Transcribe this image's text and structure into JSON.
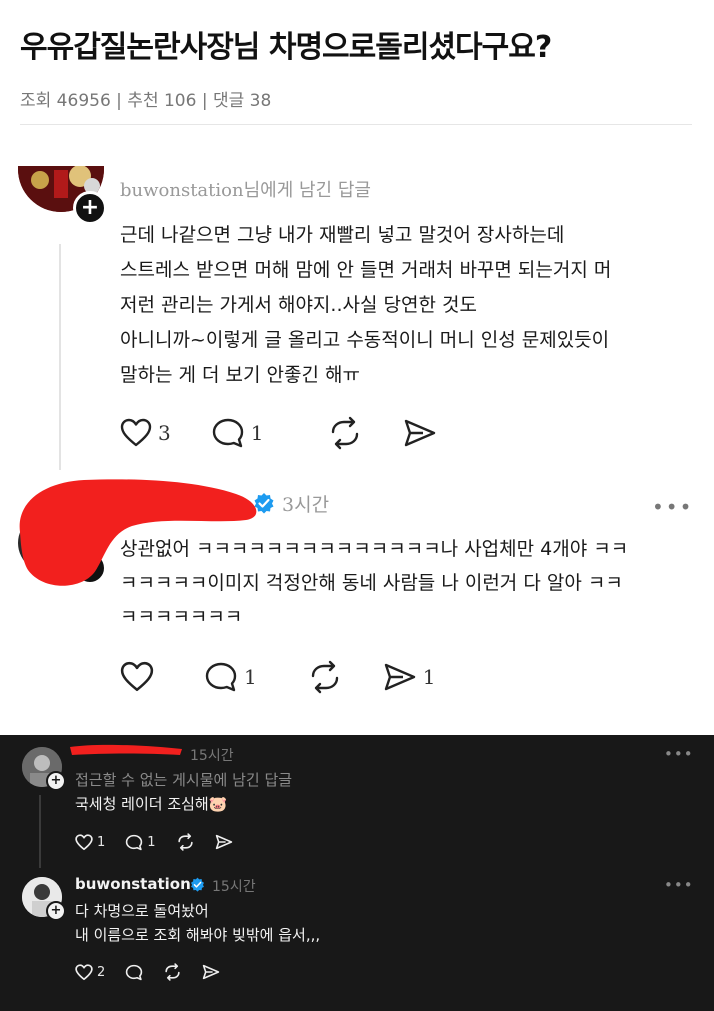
{
  "post": {
    "title": "우유갑질논란사장님 차명으로돌리셨다구요?",
    "stats": "조회 46956 | 추천 106 | 댓글 38"
  },
  "comment1": {
    "reply_to": "buwonstation님에게 남긴 답글",
    "lines": [
      "근데 나같으면 그냥 내가 재빨리 넣고 말것어 장사하는데",
      "스트레스 받으면 머해 맘에 안 들면 거래처 바꾸면 되는거지 머",
      "저런 관리는 가게서 해야지..사실 당연한 것도",
      "아니니까~이렇게 글 올리고 수동적이니 머니 인성 문제있듯이",
      "말하는 게 더 보기 안좋긴 해ㅠ"
    ],
    "likes": "3",
    "replies": "1"
  },
  "comment2": {
    "time": "3시간",
    "lines": [
      "상관없어 ㅋㅋㅋㅋㅋㅋㅋㅋㅋㅋㅋㅋㅋㅋ나 사업체만 4개야 ㅋㅋ",
      "ㅋㅋㅋㅋㅋ이미지 걱정안해 동네 사람들 나 이런거 다 알아 ㅋㅋ",
      "ㅋㅋㅋㅋㅋㅋㅋ"
    ],
    "replies": "1",
    "shares": "1"
  },
  "dark1": {
    "time": "15시간",
    "sub": "접근할 수 없는 게시물에 남긴 답글",
    "text": "국세청 레이더 조심해🐷",
    "likes": "1",
    "replies": "1"
  },
  "dark2": {
    "name": "buwonstation",
    "time": "15시간",
    "lines": [
      "다 차명으로 돌여놨어",
      "내 이름으로 조회 해봐야 빚밖에 읍서,,,"
    ],
    "likes": "2"
  },
  "icons": {
    "more": "•••",
    "plus": "+"
  },
  "colors": {
    "verified": "#1d9bf0",
    "redact": "#f2201e",
    "dark_bg": "#181818"
  }
}
